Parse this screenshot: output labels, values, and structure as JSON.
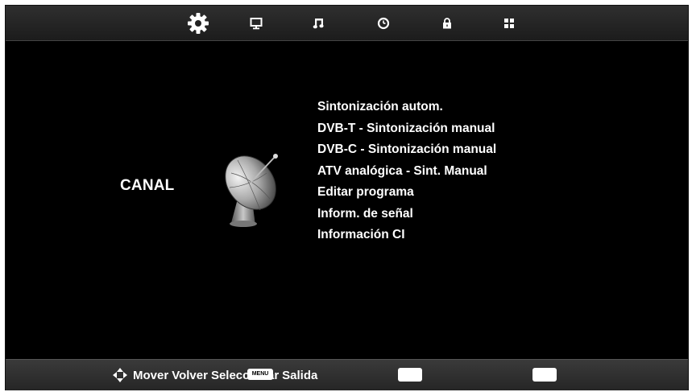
{
  "top_tabs": [
    {
      "icon": "gear-icon"
    },
    {
      "icon": "monitor-icon"
    },
    {
      "icon": "music-note-icon"
    },
    {
      "icon": "clock-icon"
    },
    {
      "icon": "lock-icon"
    },
    {
      "icon": "grid-icon"
    }
  ],
  "section": {
    "title": "CANAL",
    "icon": "satellite-dish-icon"
  },
  "menu_items": [
    "Sintonización autom.",
    "DVB-T - Sintonización manual",
    "DVB-C - Sintonización manual",
    "ATV analógica - Sint. Manual",
    "Editar programa",
    "Inform. de señal",
    "Información CI"
  ],
  "footer": {
    "move": "Mover",
    "back": "Volver",
    "select": "Seleccionar",
    "exit": "Salida",
    "menu_key": "MENU"
  },
  "colors": {
    "background": "#000000",
    "bar": "#2a2a2a",
    "text": "#ffffff"
  }
}
